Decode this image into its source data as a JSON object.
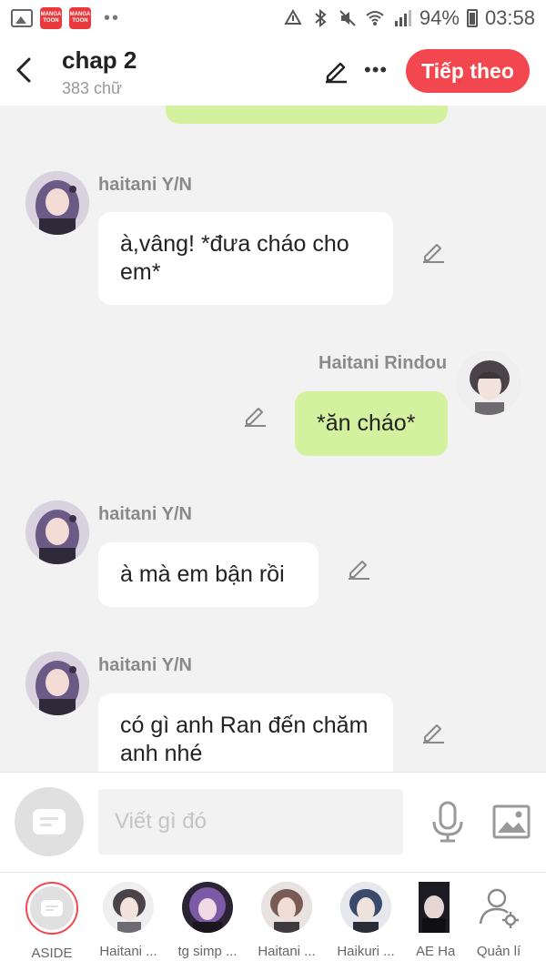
{
  "status_bar": {
    "app_badge": "MANGA TOON",
    "battery": "94%",
    "time": "03:58"
  },
  "header": {
    "title": "chap 2",
    "word_count": "383 chữ",
    "next_button": "Tiếp theo"
  },
  "messages": [
    {
      "sender": "haitani Y/N",
      "side": "left",
      "text": "à,vâng! *đưa cháo cho em*"
    },
    {
      "sender": "Haitani Rindou",
      "side": "right",
      "text": "*ăn cháo*"
    },
    {
      "sender": "haitani Y/N",
      "side": "left",
      "text": "à mà em bận rồi"
    },
    {
      "sender": "haitani Y/N",
      "side": "left",
      "text": "có gì anh Ran đến chăm anh nhé"
    }
  ],
  "input": {
    "placeholder": "Viết gì đó"
  },
  "characters": [
    {
      "label": "ASIDE",
      "selected": true
    },
    {
      "label": "Haitani ..."
    },
    {
      "label": "tg simp ..."
    },
    {
      "label": "Haitani ..."
    },
    {
      "label": "Haikuri ..."
    },
    {
      "label": "AE Ha"
    },
    {
      "label": "Quản lí"
    }
  ],
  "colors": {
    "accent": "#f2474e",
    "bubble_self": "#d4f1a0",
    "bubble_other": "#ffffff",
    "background": "#f2f2f2"
  }
}
